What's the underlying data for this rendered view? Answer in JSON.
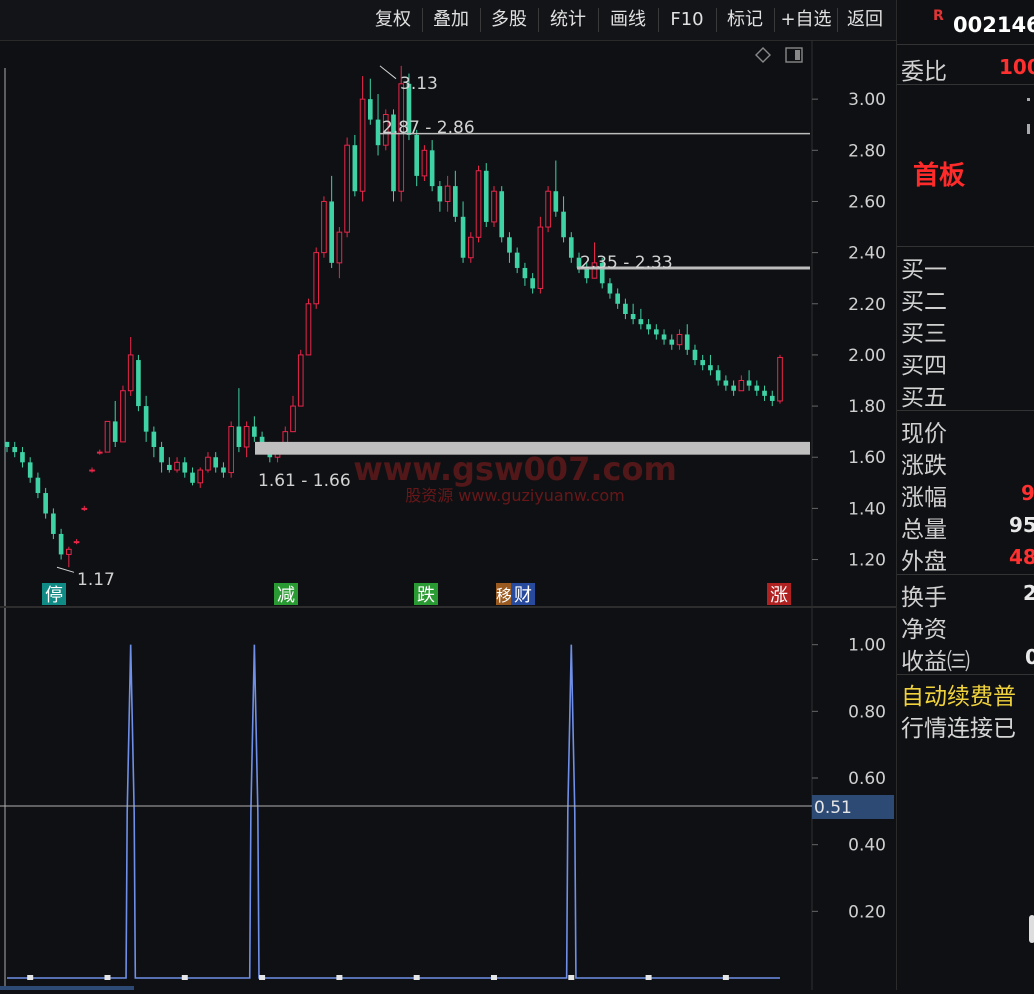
{
  "toolbar": {
    "buttons": [
      "复权",
      "叠加",
      "多股",
      "统计",
      "画线",
      "F10",
      "标记",
      "+自选",
      "返回"
    ]
  },
  "right_panel": {
    "flag": "R",
    "code": "002146",
    "weibi_label": "委比",
    "weibi_value": "100",
    "board_label": "首板",
    "buy_labels": [
      "买一",
      "买二",
      "买三",
      "买四",
      "买五"
    ],
    "stats": [
      {
        "label": "现价",
        "value": ""
      },
      {
        "label": "涨跌",
        "value": ""
      },
      {
        "label": "涨幅",
        "value": "9"
      },
      {
        "label": "总量",
        "value": "95"
      },
      {
        "label": "外盘",
        "value": "48"
      },
      {
        "label": "换手",
        "value": "2"
      },
      {
        "label": "净资",
        "value": ""
      },
      {
        "label": "收益㈢",
        "value": "0"
      }
    ],
    "ticker_lines": [
      "自动续费普",
      "行情连接已"
    ]
  },
  "chart_data": [
    {
      "type": "candlestick",
      "panel": "price",
      "y_ticks": [
        1.2,
        1.4,
        1.6,
        1.8,
        2.0,
        2.2,
        2.4,
        2.6,
        2.8,
        3.0
      ],
      "ylim": [
        1.12,
        3.2
      ],
      "annotations": {
        "high": "3.13",
        "low": "1.17",
        "resistance_1": "2.87 - 2.86",
        "resistance_2": "2.35 - 2.33",
        "support": "1.61 - 1.66"
      },
      "markers": [
        {
          "label": "停",
          "color": "#0f8a84"
        },
        {
          "label": "减",
          "color": "#2a9a32"
        },
        {
          "label": "跌",
          "color": "#2a9a32"
        },
        {
          "label": "移",
          "color": "#9a5a20"
        },
        {
          "label": "财",
          "color": "#284a9c"
        },
        {
          "label": "涨",
          "color": "#b02222"
        }
      ],
      "watermark_main": "www.gsw007.com",
      "watermark_sub": "股资源 www.guziyuanw.com",
      "candles": [
        [
          1.66,
          1.66,
          1.62,
          1.64
        ],
        [
          1.64,
          1.66,
          1.6,
          1.62
        ],
        [
          1.62,
          1.64,
          1.56,
          1.58
        ],
        [
          1.58,
          1.6,
          1.5,
          1.52
        ],
        [
          1.52,
          1.54,
          1.44,
          1.46
        ],
        [
          1.46,
          1.48,
          1.36,
          1.38
        ],
        [
          1.38,
          1.4,
          1.28,
          1.3
        ],
        [
          1.3,
          1.32,
          1.2,
          1.22
        ],
        [
          1.22,
          1.25,
          1.17,
          1.24
        ],
        [
          1.27,
          1.28,
          1.26,
          1.27
        ],
        [
          1.4,
          1.41,
          1.39,
          1.4
        ],
        [
          1.55,
          1.56,
          1.54,
          1.55
        ],
        [
          1.62,
          1.63,
          1.61,
          1.62
        ],
        [
          1.62,
          1.74,
          1.62,
          1.74
        ],
        [
          1.74,
          1.82,
          1.64,
          1.66
        ],
        [
          1.66,
          1.88,
          1.66,
          1.86
        ],
        [
          1.86,
          2.07,
          1.84,
          2.0
        ],
        [
          1.98,
          2.0,
          1.78,
          1.8
        ],
        [
          1.8,
          1.84,
          1.66,
          1.7
        ],
        [
          1.7,
          1.72,
          1.6,
          1.64
        ],
        [
          1.64,
          1.66,
          1.54,
          1.58
        ],
        [
          1.57,
          1.6,
          1.54,
          1.55
        ],
        [
          1.55,
          1.6,
          1.54,
          1.58
        ],
        [
          1.58,
          1.6,
          1.52,
          1.54
        ],
        [
          1.54,
          1.56,
          1.49,
          1.5
        ],
        [
          1.5,
          1.56,
          1.48,
          1.55
        ],
        [
          1.55,
          1.62,
          1.54,
          1.6
        ],
        [
          1.6,
          1.62,
          1.54,
          1.56
        ],
        [
          1.56,
          1.58,
          1.52,
          1.54
        ],
        [
          1.54,
          1.74,
          1.52,
          1.72
        ],
        [
          1.72,
          1.87,
          1.62,
          1.64
        ],
        [
          1.64,
          1.74,
          1.6,
          1.72
        ],
        [
          1.72,
          1.76,
          1.66,
          1.68
        ],
        [
          1.68,
          1.7,
          1.62,
          1.64
        ],
        [
          1.64,
          1.66,
          1.58,
          1.6
        ],
        [
          1.6,
          1.64,
          1.58,
          1.62
        ],
        [
          1.62,
          1.72,
          1.62,
          1.7
        ],
        [
          1.7,
          1.84,
          1.7,
          1.8
        ],
        [
          1.8,
          2.02,
          1.8,
          2.0
        ],
        [
          2.0,
          2.22,
          2.0,
          2.2
        ],
        [
          2.2,
          2.42,
          2.18,
          2.4
        ],
        [
          2.4,
          2.62,
          2.38,
          2.6
        ],
        [
          2.6,
          2.7,
          2.34,
          2.36
        ],
        [
          2.36,
          2.5,
          2.3,
          2.48
        ],
        [
          2.48,
          2.85,
          2.46,
          2.82
        ],
        [
          2.82,
          2.86,
          2.62,
          2.64
        ],
        [
          2.64,
          3.09,
          2.6,
          3.0
        ],
        [
          3.0,
          3.08,
          2.9,
          2.92
        ],
        [
          2.92,
          3.02,
          2.78,
          2.82
        ],
        [
          2.82,
          2.96,
          2.8,
          2.94
        ],
        [
          2.94,
          2.96,
          2.6,
          2.64
        ],
        [
          2.64,
          3.13,
          2.6,
          3.06
        ],
        [
          3.06,
          3.1,
          2.84,
          2.86
        ],
        [
          2.86,
          2.88,
          2.66,
          2.7
        ],
        [
          2.7,
          2.82,
          2.68,
          2.8
        ],
        [
          2.8,
          2.84,
          2.64,
          2.66
        ],
        [
          2.66,
          2.68,
          2.56,
          2.6
        ],
        [
          2.6,
          2.7,
          2.56,
          2.66
        ],
        [
          2.66,
          2.72,
          2.52,
          2.54
        ],
        [
          2.54,
          2.6,
          2.36,
          2.38
        ],
        [
          2.38,
          2.48,
          2.36,
          2.46
        ],
        [
          2.46,
          2.74,
          2.44,
          2.72
        ],
        [
          2.72,
          2.75,
          2.5,
          2.52
        ],
        [
          2.52,
          2.66,
          2.5,
          2.64
        ],
        [
          2.64,
          2.66,
          2.44,
          2.46
        ],
        [
          2.46,
          2.48,
          2.36,
          2.4
        ],
        [
          2.4,
          2.42,
          2.32,
          2.34
        ],
        [
          2.34,
          2.36,
          2.27,
          2.3
        ],
        [
          2.3,
          2.32,
          2.24,
          2.26
        ],
        [
          2.26,
          2.54,
          2.24,
          2.5
        ],
        [
          2.5,
          2.66,
          2.48,
          2.64
        ],
        [
          2.64,
          2.76,
          2.54,
          2.56
        ],
        [
          2.56,
          2.62,
          2.44,
          2.46
        ],
        [
          2.46,
          2.48,
          2.36,
          2.38
        ],
        [
          2.38,
          2.4,
          2.32,
          2.34
        ],
        [
          2.34,
          2.36,
          2.28,
          2.3
        ],
        [
          2.3,
          2.44,
          2.3,
          2.36
        ],
        [
          2.36,
          2.38,
          2.26,
          2.28
        ],
        [
          2.28,
          2.3,
          2.22,
          2.24
        ],
        [
          2.24,
          2.26,
          2.18,
          2.2
        ],
        [
          2.2,
          2.22,
          2.14,
          2.16
        ],
        [
          2.16,
          2.2,
          2.12,
          2.14
        ],
        [
          2.14,
          2.18,
          2.1,
          2.12
        ],
        [
          2.12,
          2.14,
          2.08,
          2.1
        ],
        [
          2.1,
          2.12,
          2.06,
          2.08
        ],
        [
          2.08,
          2.1,
          2.04,
          2.06
        ],
        [
          2.06,
          2.08,
          2.02,
          2.04
        ],
        [
          2.04,
          2.1,
          2.02,
          2.08
        ],
        [
          2.08,
          2.12,
          2.0,
          2.02
        ],
        [
          2.02,
          2.04,
          1.96,
          1.98
        ],
        [
          1.98,
          2.0,
          1.94,
          1.96
        ],
        [
          1.96,
          2.0,
          1.92,
          1.94
        ],
        [
          1.94,
          1.96,
          1.88,
          1.9
        ],
        [
          1.9,
          1.92,
          1.86,
          1.88
        ],
        [
          1.88,
          1.9,
          1.84,
          1.86
        ],
        [
          1.86,
          1.92,
          1.86,
          1.9
        ],
        [
          1.9,
          1.94,
          1.86,
          1.88
        ],
        [
          1.88,
          1.9,
          1.84,
          1.86
        ],
        [
          1.86,
          1.88,
          1.82,
          1.84
        ],
        [
          1.84,
          1.86,
          1.8,
          1.82
        ],
        [
          1.82,
          2.0,
          1.81,
          1.99
        ]
      ]
    },
    {
      "type": "line",
      "panel": "indicator",
      "y_ticks": [
        0.2,
        0.4,
        0.6,
        0.8,
        1.0
      ],
      "ylim": [
        0.0,
        1.05
      ],
      "cursor_value": "0.51",
      "spikes_at_index": [
        16,
        32,
        73
      ],
      "series_length": 101
    }
  ]
}
